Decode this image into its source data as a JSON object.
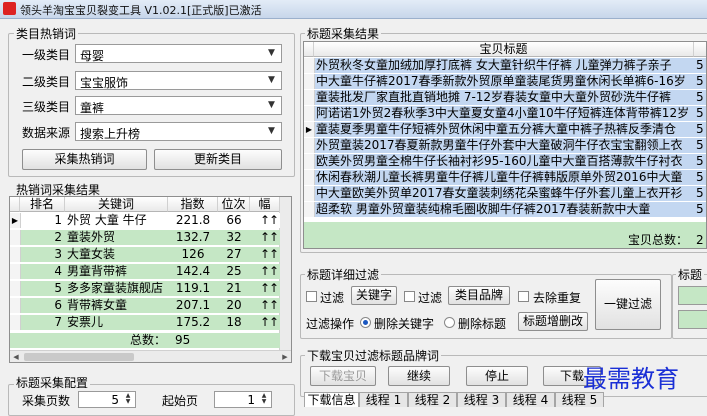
{
  "window": {
    "title": "领头羊淘宝宝贝裂变工具 V1.02.1[正式版]已激活"
  },
  "category": {
    "group_label": "类目热销词",
    "level1_label": "一级类目",
    "level1_value": "母婴",
    "level2_label": "二级类目",
    "level2_value": "宝宝服饰",
    "level3_label": "三级类目",
    "level3_value": "童裤",
    "source_label": "数据来源",
    "source_value": "搜索上升榜",
    "collect_button": "采集热销词",
    "update_button": "更新类目"
  },
  "hotwords": {
    "group_label": "热销词采集结果",
    "columns": [
      "排名",
      "关键词",
      "指数",
      "位次",
      "幅"
    ],
    "rows": [
      {
        "rank": "1",
        "keyword": "外贸 大童 牛仔",
        "index": "221.8",
        "pos": "66",
        "up": "↑",
        "amp": "↑"
      },
      {
        "rank": "2",
        "keyword": "童装外贸",
        "index": "132.7",
        "pos": "32",
        "up": "↑",
        "amp": "↑"
      },
      {
        "rank": "3",
        "keyword": "大童女装",
        "index": "126",
        "pos": "27",
        "up": "↑",
        "amp": "↑"
      },
      {
        "rank": "4",
        "keyword": "男童背带裤",
        "index": "142.4",
        "pos": "25",
        "up": "↑",
        "amp": "↑"
      },
      {
        "rank": "5",
        "keyword": "多多家童装旗舰店",
        "index": "119.1",
        "pos": "21",
        "up": "↑",
        "amp": "↑"
      },
      {
        "rank": "6",
        "keyword": "背带裤女童",
        "index": "207.1",
        "pos": "20",
        "up": "↑",
        "amp": "↑"
      },
      {
        "rank": "7",
        "keyword": "安票儿",
        "index": "175.2",
        "pos": "18",
        "up": "↑",
        "amp": "↑"
      }
    ],
    "total_label": "总数：",
    "total_value": "95"
  },
  "title_config": {
    "group_label": "标题采集配置",
    "pages_label": "采集页数",
    "pages_value": "5",
    "start_label": "起始页",
    "start_value": "1"
  },
  "titles": {
    "group_label": "标题采集结果",
    "column": "宝贝标题",
    "rows": [
      "外贸秋冬女童加绒加厚打底裤 女大童针织牛仔裤 儿童弹力裤子亲子",
      "中大童牛仔裤2017春季新款外贸原单童装尾货男童休闲长单裤6-16岁",
      "童装批发厂家直批直销地摊 7-12岁春装女童中大童外贸砂洗牛仔裤",
      "阿诺诺1外贸2春秋季3中大童夏女童4小童10牛仔短裤连体背带裤12岁",
      "童装夏季男童牛仔短裤外贸休闲中童五分裤大童中裤子热裤反季清仓",
      "外贸童装2017春夏新款男童牛仔外套中大童破洞牛仔衣宝宝翻领上衣",
      "欧美外贸男童全棉牛仔长袖衬衫95-160儿童中大童百搭薄款牛仔衬衣",
      "休闲春秋潮儿童长裤男童牛仔裤儿童牛仔裤韩版原单外贸2016中大童",
      "中大童欧美外贸单2017春女童装刺绣花朵蜜蜂牛仔外套儿童上衣开衫",
      "超柔软 男童外贸童装纯棉毛圈收脚牛仔裤2017春装新款中大童"
    ],
    "rows_edge": "5",
    "total_label": "宝贝总数：",
    "total_value": "2"
  },
  "filter": {
    "group_label": "标题详细过滤",
    "filter1_label": "过滤",
    "keyword_button": "关键字",
    "filter2_label": "过滤",
    "brand_button": "类目品牌",
    "dedupe_label": "去除重复",
    "one_click_button": "一键过滤",
    "op_label": "过滤操作",
    "radio1_label": "删除关键字",
    "radio2_label": "删除标题",
    "add_delete_button": "标题增删改"
  },
  "side_group_label": "标题",
  "download": {
    "group_label": "下载宝贝过滤标题品牌词",
    "download_button": "下载宝贝",
    "continue_button": "继续",
    "stop_button": "停止",
    "down_button": "下载"
  },
  "tabs": [
    "下载信息",
    "线程 1",
    "线程 2",
    "线程 3",
    "线程 4",
    "线程 5"
  ],
  "watermark": "最需教育",
  "colors": {
    "row_green": "#c5e7c5",
    "row_blue": "#c3d7f1",
    "selected": "#bcd0ea",
    "accent": "#1a57c0"
  }
}
